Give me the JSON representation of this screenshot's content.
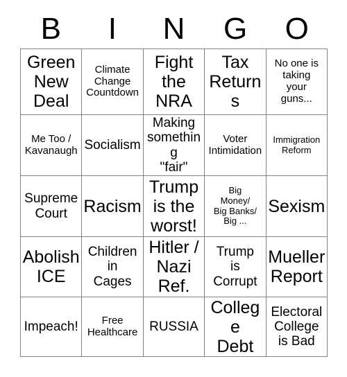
{
  "card": {
    "headers": [
      "B",
      "I",
      "N",
      "G",
      "O"
    ],
    "line_color": "#808080",
    "text_color": "#000000",
    "background_color": "#ffffff",
    "rows": [
      [
        {
          "text": "Green\nNew\nDeal",
          "size": "xl"
        },
        {
          "text": "Climate\nChange\nCountdown",
          "size": "sm"
        },
        {
          "text": "Fight\nthe\nNRA",
          "size": "xl"
        },
        {
          "text": "Tax\nReturns",
          "size": "xl"
        },
        {
          "text": "No one is\ntaking\nyour\nguns...",
          "size": "sm"
        }
      ],
      [
        {
          "text": "Me Too /\nKavanaugh",
          "size": "sm"
        },
        {
          "text": "Socialism",
          "size": "md"
        },
        {
          "text": "Making\nsomething\n\"fair\"",
          "size": "md"
        },
        {
          "text": "Voter\nIntimidation",
          "size": "sm"
        },
        {
          "text": "Immigration\nReform",
          "size": "xs"
        }
      ],
      [
        {
          "text": "Supreme\nCourt",
          "size": "md"
        },
        {
          "text": "Racism",
          "size": "xl"
        },
        {
          "text": "Trump\nis the\nworst!",
          "size": "xl"
        },
        {
          "text": "Big\nMoney/\nBig Banks/\nBig ...",
          "size": "xs"
        },
        {
          "text": "Sexism",
          "size": "xl"
        }
      ],
      [
        {
          "text": "Abolish\nICE",
          "size": "xl"
        },
        {
          "text": "Children\nin\nCages",
          "size": "md"
        },
        {
          "text": "Hitler /\nNazi\nRef.",
          "size": "xl"
        },
        {
          "text": "Trump\nis\nCorrupt",
          "size": "md"
        },
        {
          "text": "Mueller\nReport",
          "size": "xl"
        }
      ],
      [
        {
          "text": "Impeach!",
          "size": "md"
        },
        {
          "text": "Free\nHealthcare",
          "size": "sm"
        },
        {
          "text": "RUSSIA",
          "size": "md"
        },
        {
          "text": "College\nDebt",
          "size": "xl"
        },
        {
          "text": "Electoral\nCollege\nis Bad",
          "size": "md"
        }
      ]
    ]
  }
}
